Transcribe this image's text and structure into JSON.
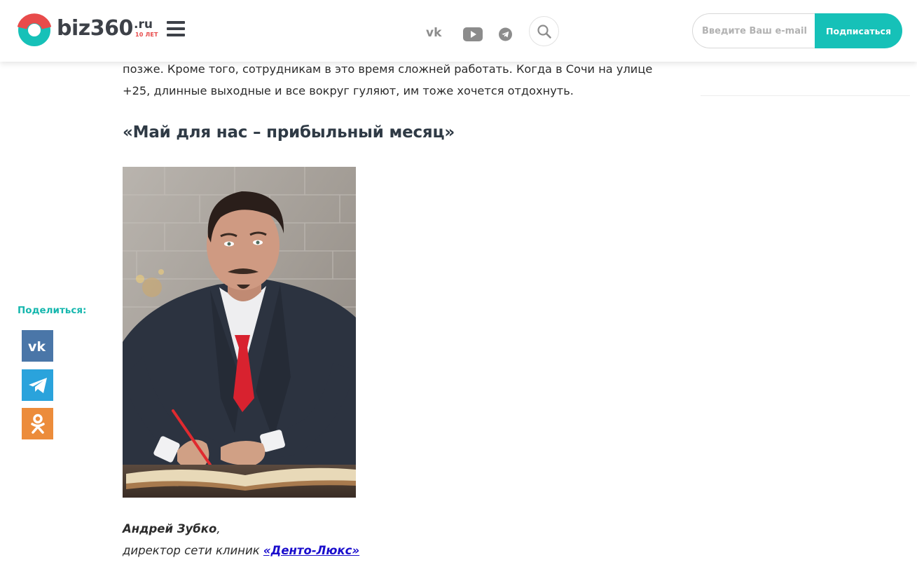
{
  "header": {
    "logo": {
      "text": "biz360",
      "domain": ".ru",
      "badge": "10 ЛЕТ"
    },
    "social_icons": [
      "vk-icon",
      "youtube-icon",
      "telegram-icon"
    ],
    "search_icon": "search-icon",
    "subscribe": {
      "placeholder": "Введите Ваш e-mail",
      "button": "Подписаться"
    }
  },
  "article": {
    "paragraph": "позже. Кроме того, сотрудникам в это время сложней работать. Когда в Сочи на улице +25, длинные выходные и все вокруг гуляют, им тоже хочется отдохнуть.",
    "heading": "«Май для нас – прибыльный месяц»",
    "caption": {
      "name": "Андрей Зубко",
      "name_suffix": ",",
      "role": "директор сети клиник ",
      "link": "«Денто-Люкс»"
    }
  },
  "share": {
    "label": "Поделиться:",
    "buttons": [
      {
        "icon": "vk-icon",
        "color": "#4a76a8"
      },
      {
        "icon": "telegram-icon",
        "color": "#2aa3dc"
      },
      {
        "icon": "odnoklassniki-icon",
        "color": "#ec8c3b"
      }
    ]
  },
  "colors": {
    "accent": "#16c1b8",
    "logo_red": "#e84b4b",
    "link": "#1a0dcc"
  }
}
